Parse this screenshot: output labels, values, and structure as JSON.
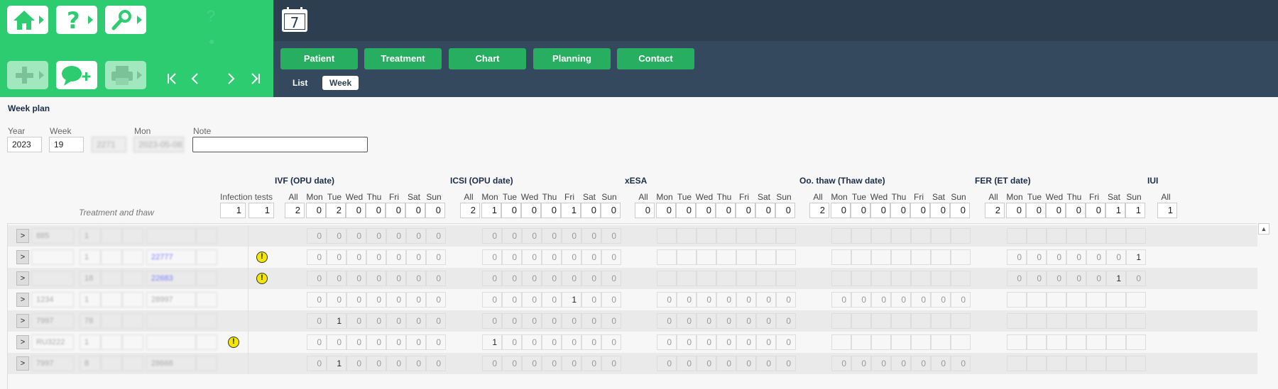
{
  "toolbar": {
    "calendar_icon_text": "7",
    "tabs": [
      "Patient",
      "Treatment",
      "Chart",
      "Planning",
      "Contact"
    ],
    "subtabs": [
      "List",
      "Week"
    ]
  },
  "page": {
    "title": "Week plan",
    "labels": {
      "year": "Year",
      "week": "Week",
      "mon": "Mon",
      "note": "Note"
    },
    "values": {
      "year": "2023",
      "week": "19",
      "blur1": "2271",
      "mon": "2023-05-08",
      "note": ""
    }
  },
  "columns": {
    "treatment_header": "Treatment and thaw",
    "infection_header": "Infection tests",
    "infection_sums": [
      "1",
      "1"
    ],
    "days": [
      "All",
      "Mon",
      "Tue",
      "Wed",
      "Thu",
      "Fri",
      "Sat",
      "Sun"
    ],
    "sections": [
      {
        "name": "IVF (OPU date)",
        "sums": [
          "2",
          "0",
          "2",
          "0",
          "0",
          "0",
          "0",
          "0"
        ]
      },
      {
        "name": "ICSI (OPU date)",
        "sums": [
          "2",
          "1",
          "0",
          "0",
          "0",
          "1",
          "0",
          "0"
        ]
      },
      {
        "name": "xESA",
        "sums": [
          "0",
          "0",
          "0",
          "0",
          "0",
          "0",
          "0",
          "0"
        ]
      },
      {
        "name": "Oo. thaw (Thaw date)",
        "sums": [
          "2",
          "0",
          "0",
          "0",
          "0",
          "0",
          "0",
          "0"
        ]
      },
      {
        "name": "FER (ET date)",
        "sums": [
          "2",
          "0",
          "0",
          "0",
          "0",
          "0",
          "1",
          "1"
        ]
      },
      {
        "name": "IUI",
        "sums": [
          "1"
        ]
      }
    ]
  },
  "rows": [
    {
      "t1": "885",
      "t2": "1",
      "t3": "",
      "t4": "",
      "warn": "",
      "ivf": [
        "0",
        "0",
        "0",
        "0",
        "0",
        "0",
        "0"
      ],
      "icsi": [
        "0",
        "0",
        "0",
        "0",
        "0",
        "0",
        "0"
      ],
      "xesa": [],
      "oo": [],
      "fer": []
    },
    {
      "t1": "",
      "t2": "1",
      "t3": "22777",
      "t4": "",
      "warn": "right",
      "ivf": [
        "0",
        "0",
        "0",
        "0",
        "0",
        "0",
        "0"
      ],
      "icsi": [
        "0",
        "0",
        "0",
        "0",
        "0",
        "0",
        "0"
      ],
      "xesa": [],
      "oo": [],
      "fer": [
        "0",
        "0",
        "0",
        "0",
        "0",
        "0",
        "1"
      ]
    },
    {
      "t1": "",
      "t2": "18",
      "t3": "22683",
      "t4": "",
      "warn": "right",
      "ivf": [
        "0",
        "0",
        "0",
        "0",
        "0",
        "0",
        "0"
      ],
      "icsi": [
        "0",
        "0",
        "0",
        "0",
        "0",
        "0",
        "0"
      ],
      "xesa": [],
      "oo": [],
      "fer": [
        "0",
        "0",
        "0",
        "0",
        "0",
        "1",
        "0"
      ]
    },
    {
      "t1": "1234",
      "t2": "1",
      "t3": "28997",
      "t4": "",
      "warn": "",
      "ivf": [
        "0",
        "0",
        "0",
        "0",
        "0",
        "0",
        "0"
      ],
      "icsi": [
        "0",
        "0",
        "0",
        "0",
        "1",
        "0",
        "0"
      ],
      "xesa": [
        "0",
        "0",
        "0",
        "0",
        "0",
        "0",
        "0"
      ],
      "oo": [
        "0",
        "0",
        "0",
        "0",
        "0",
        "0",
        "0"
      ],
      "fer": []
    },
    {
      "t1": "7997",
      "t2": "78",
      "t3": "",
      "t4": "",
      "warn": "",
      "ivf": [
        "0",
        "1",
        "0",
        "0",
        "0",
        "0",
        "0"
      ],
      "icsi": [
        "0",
        "0",
        "0",
        "0",
        "0",
        "0",
        "0"
      ],
      "xesa": [
        "0",
        "0",
        "0",
        "0",
        "0",
        "0",
        "0"
      ],
      "oo": [],
      "fer": []
    },
    {
      "t1": "RU3222",
      "t2": "1",
      "t3": "",
      "t4": "",
      "warn": "left",
      "ivf": [
        "0",
        "0",
        "0",
        "0",
        "0",
        "0",
        "0"
      ],
      "icsi": [
        "1",
        "0",
        "0",
        "0",
        "0",
        "0",
        "0"
      ],
      "xesa": [
        "0",
        "0",
        "0",
        "0",
        "0",
        "0",
        "0"
      ],
      "oo": [],
      "fer": []
    },
    {
      "t1": "7997",
      "t2": "8",
      "t3": "28668",
      "t4": "",
      "warn": "",
      "ivf": [
        "0",
        "1",
        "0",
        "0",
        "0",
        "0",
        "0"
      ],
      "icsi": [
        "0",
        "0",
        "0",
        "0",
        "0",
        "0",
        "0"
      ],
      "xesa": [
        "0",
        "0",
        "0",
        "0",
        "0",
        "0",
        "0"
      ],
      "oo": [
        "0",
        "0",
        "0",
        "0",
        "0",
        "0",
        "0"
      ],
      "fer": []
    }
  ],
  "colors": {
    "green": "#2ecc71",
    "dark_green": "#27ae60",
    "navy": "#2c3e50",
    "slate": "#34495e"
  }
}
